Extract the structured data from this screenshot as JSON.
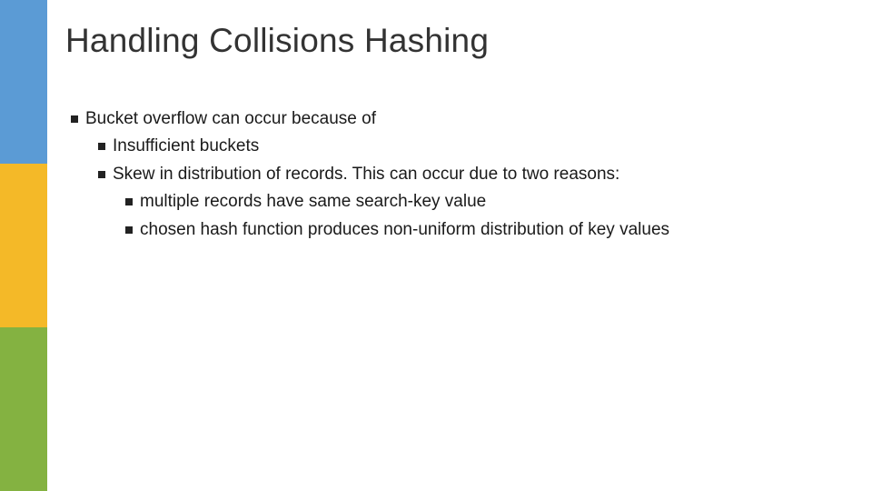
{
  "slide": {
    "title": "Handling Collisions Hashing",
    "bullets": {
      "b1": "Bucket overflow can occur because of",
      "b1a": "Insufficient buckets",
      "b1b": "Skew in distribution of records.  This can occur due to two reasons:",
      "b1b1": "multiple records have same search-key value",
      "b1b2": "chosen hash function produces non-uniform distribution of key values"
    }
  },
  "colors": {
    "blue": "#5b9bd5",
    "yellow": "#f4b928",
    "green": "#84b241"
  }
}
